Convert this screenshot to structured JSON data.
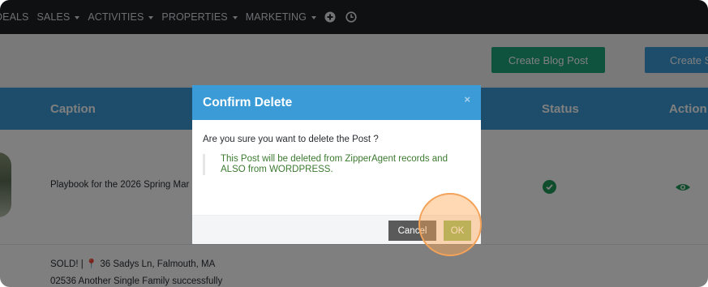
{
  "nav": {
    "items": [
      "DEALS",
      "SALES",
      "ACTIVITIES",
      "PROPERTIES",
      "MARKETING"
    ],
    "plus_icon": "plus-circle-icon",
    "clock_icon": "clock-icon"
  },
  "toolbar": {
    "create_blog_post": "Create Blog Post",
    "create_s": "Create S"
  },
  "table": {
    "headers": {
      "caption": "Caption",
      "status": "Status",
      "actions": "Action"
    },
    "row1": {
      "caption": "Playbook for the 2026 Spring Mar"
    },
    "row2": {
      "line1": "SOLD! | 📍 36 Sadys Ln, Falmouth, MA",
      "line2": "02536 Another Single Family successfully"
    }
  },
  "modal": {
    "title": "Confirm Delete",
    "close": "×",
    "question": "Are you sure you want to delete the Post ?",
    "warning": "This Post will be deleted from ZipperAgent records and ALSO from WORDPRESS.",
    "cancel": "Cancel",
    "ok": "OK"
  },
  "colors": {
    "nav_bg": "#1d2025",
    "accent_blue": "#3b9bd6",
    "green_button": "#1fa57a",
    "ok_green": "#86b85a",
    "highlight": "#f3a258"
  }
}
